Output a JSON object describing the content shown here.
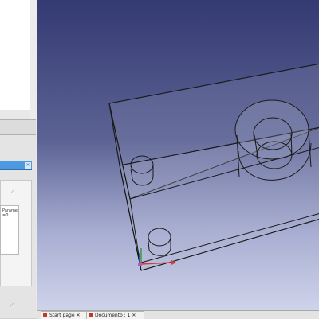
{
  "left_panel": {
    "task_close_glyph": "×",
    "parameter_box_text": "Parameter\n=0"
  },
  "viewport": {
    "icons": {
      "axis_indicator": "axis-triad-icon"
    },
    "colors": {
      "background_top": "#343a72",
      "background_bottom": "#cfd3ea",
      "edges": "#1a1a1a",
      "faces": "#9aa0c0",
      "axis_x": "#d63a3a",
      "axis_y": "#3a9a3a",
      "axis_z": "#3a5fd6"
    }
  },
  "tabs": [
    {
      "label": "Start page ✕",
      "icon": "page-icon"
    },
    {
      "label": "Documento : 1 ✕",
      "icon": "part-icon"
    }
  ]
}
